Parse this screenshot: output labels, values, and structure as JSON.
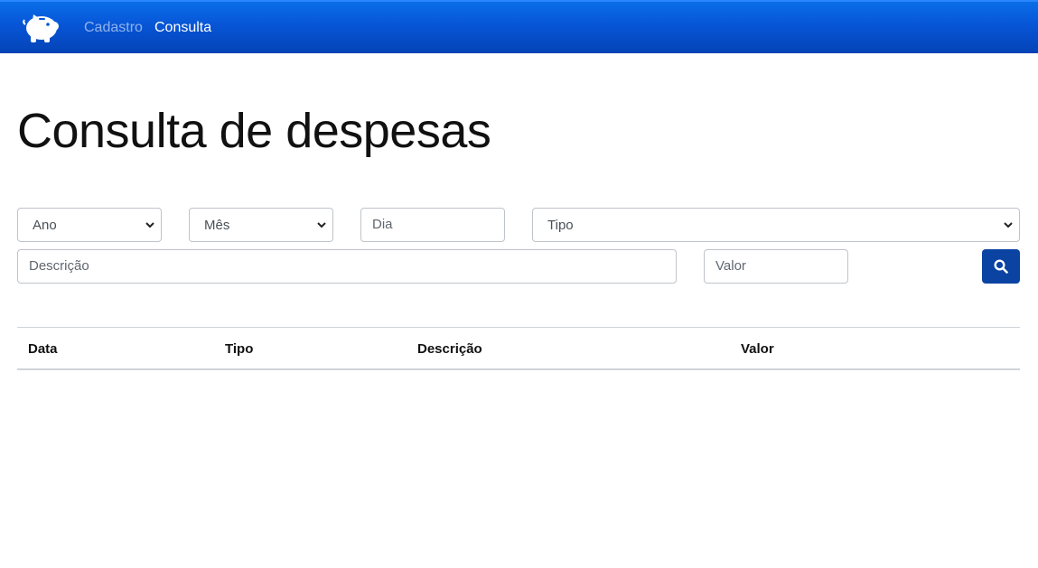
{
  "navbar": {
    "brand_icon": "piggy-bank-icon",
    "links": [
      {
        "label": "Cadastro",
        "active": false
      },
      {
        "label": "Consulta",
        "active": true
      }
    ],
    "colors": {
      "gradient_top": "#0a6ee8",
      "gradient_bottom": "#0443b6"
    }
  },
  "page": {
    "title": "Consulta de despesas"
  },
  "filters": {
    "ano": {
      "selected": "Ano"
    },
    "mes": {
      "selected": "Mês"
    },
    "dia": {
      "placeholder": "Dia"
    },
    "tipo": {
      "selected": "Tipo"
    },
    "descricao": {
      "placeholder": "Descrição"
    },
    "valor": {
      "placeholder": "Valor"
    },
    "search_icon": "search-icon",
    "search_button_color": "#0b43a2"
  },
  "table": {
    "headers": [
      "Data",
      "Tipo",
      "Descrição",
      "Valor"
    ],
    "rows": []
  }
}
